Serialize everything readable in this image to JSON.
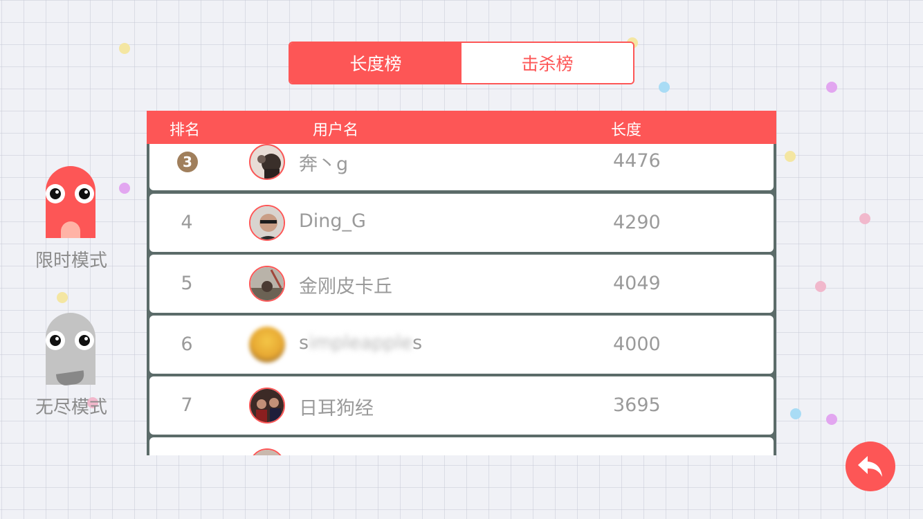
{
  "tabs": {
    "length_tab": "长度榜",
    "kills_tab": "击杀榜"
  },
  "modes": {
    "timed": "限时模式",
    "endless": "无尽模式"
  },
  "table": {
    "headers": {
      "rank": "排名",
      "username": "用户名",
      "length": "长度"
    },
    "rows": [
      {
        "rank": "3",
        "name": "奔丶g",
        "score": "4476"
      },
      {
        "rank": "4",
        "name": "Ding_G",
        "score": "4290"
      },
      {
        "rank": "5",
        "name": "金刚皮卡丘",
        "score": "4049"
      },
      {
        "rank": "6",
        "name_start": "s",
        "name_blurred": "impleapple",
        "name_end": "s",
        "score": "4000"
      },
      {
        "rank": "7",
        "name": "日耳狗经",
        "score": "3695"
      }
    ]
  },
  "colors": {
    "accent": "#fd5656",
    "table_bg": "#5b6b69",
    "text_gray": "#9a9a9a",
    "medal_bronze": "#a07f5c"
  },
  "icons": {
    "back": "back-arrow-icon"
  }
}
